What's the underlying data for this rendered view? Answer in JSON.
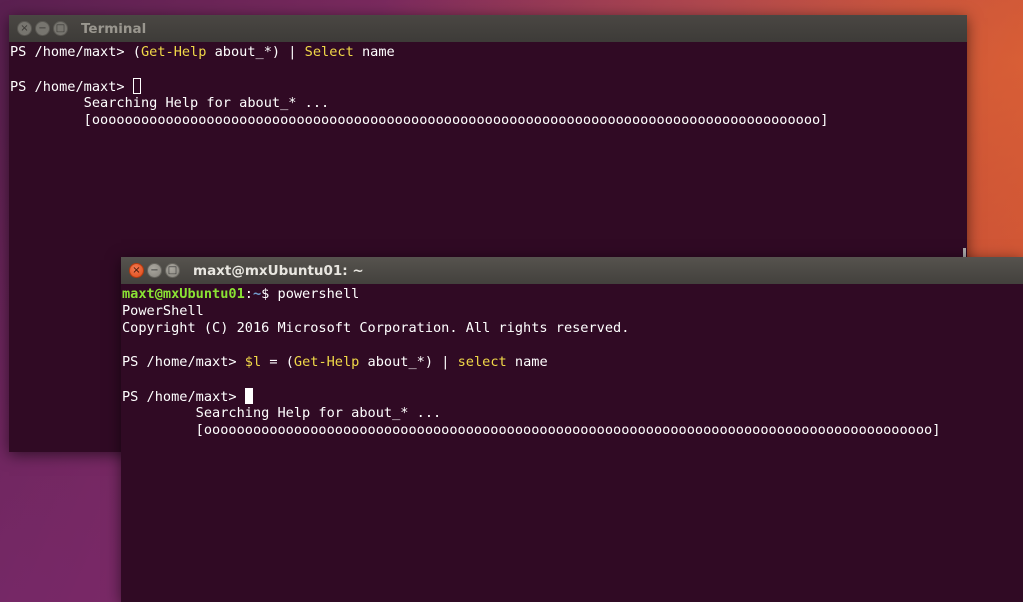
{
  "windows": [
    {
      "title": "Terminal",
      "state": "inactive",
      "lines": [
        {
          "parts": [
            {
              "t": "PS /home/maxt> ",
              "c": "w"
            },
            {
              "t": "(",
              "c": "w"
            },
            {
              "t": "Get-Help",
              "c": "y"
            },
            {
              "t": " about_*) | ",
              "c": "w"
            },
            {
              "t": "Select",
              "c": "y"
            },
            {
              "t": " name",
              "c": "w"
            }
          ]
        },
        {
          "parts": []
        },
        {
          "parts": [
            {
              "t": "PS /home/maxt> ",
              "c": "w"
            }
          ],
          "cursor": "hollow"
        },
        {
          "parts": [
            {
              "t": "         Searching Help for about_* ...",
              "c": "w"
            }
          ]
        },
        {
          "parts": [
            {
              "t": "         [ooooooooooooooooooooooooooooooooooooooooooooooooooooooooooooooooooooooooooooooooooooooooo]",
              "c": "w"
            }
          ]
        }
      ]
    },
    {
      "title": "maxt@mxUbuntu01: ~",
      "state": "active",
      "lines": [
        {
          "parts": [
            {
              "t": "maxt@mxUbuntu01",
              "c": "g"
            },
            {
              "t": ":",
              "c": "w"
            },
            {
              "t": "~",
              "c": "b"
            },
            {
              "t": "$ powershell",
              "c": "w"
            }
          ]
        },
        {
          "parts": [
            {
              "t": "PowerShell",
              "c": "w"
            }
          ]
        },
        {
          "parts": [
            {
              "t": "Copyright (C) 2016 Microsoft Corporation. All rights reserved.",
              "c": "w"
            }
          ]
        },
        {
          "parts": []
        },
        {
          "parts": [
            {
              "t": "PS /home/maxt> ",
              "c": "w"
            },
            {
              "t": "$l",
              "c": "y"
            },
            {
              "t": " = (",
              "c": "w"
            },
            {
              "t": "Get-Help",
              "c": "y"
            },
            {
              "t": " about_*) | ",
              "c": "w"
            },
            {
              "t": "select",
              "c": "y"
            },
            {
              "t": " name",
              "c": "w"
            }
          ]
        },
        {
          "parts": []
        },
        {
          "parts": [
            {
              "t": "PS /home/maxt> ",
              "c": "w"
            }
          ],
          "cursor": "solid"
        },
        {
          "parts": [
            {
              "t": "         Searching Help for about_* ...",
              "c": "w"
            }
          ]
        },
        {
          "parts": [
            {
              "t": "         [ooooooooooooooooooooooooooooooooooooooooooooooooooooooooooooooooooooooooooooooooooooooooo]",
              "c": "w"
            }
          ]
        }
      ]
    }
  ],
  "icons": {
    "close": "×",
    "minimize": "−",
    "maximize": "□"
  }
}
